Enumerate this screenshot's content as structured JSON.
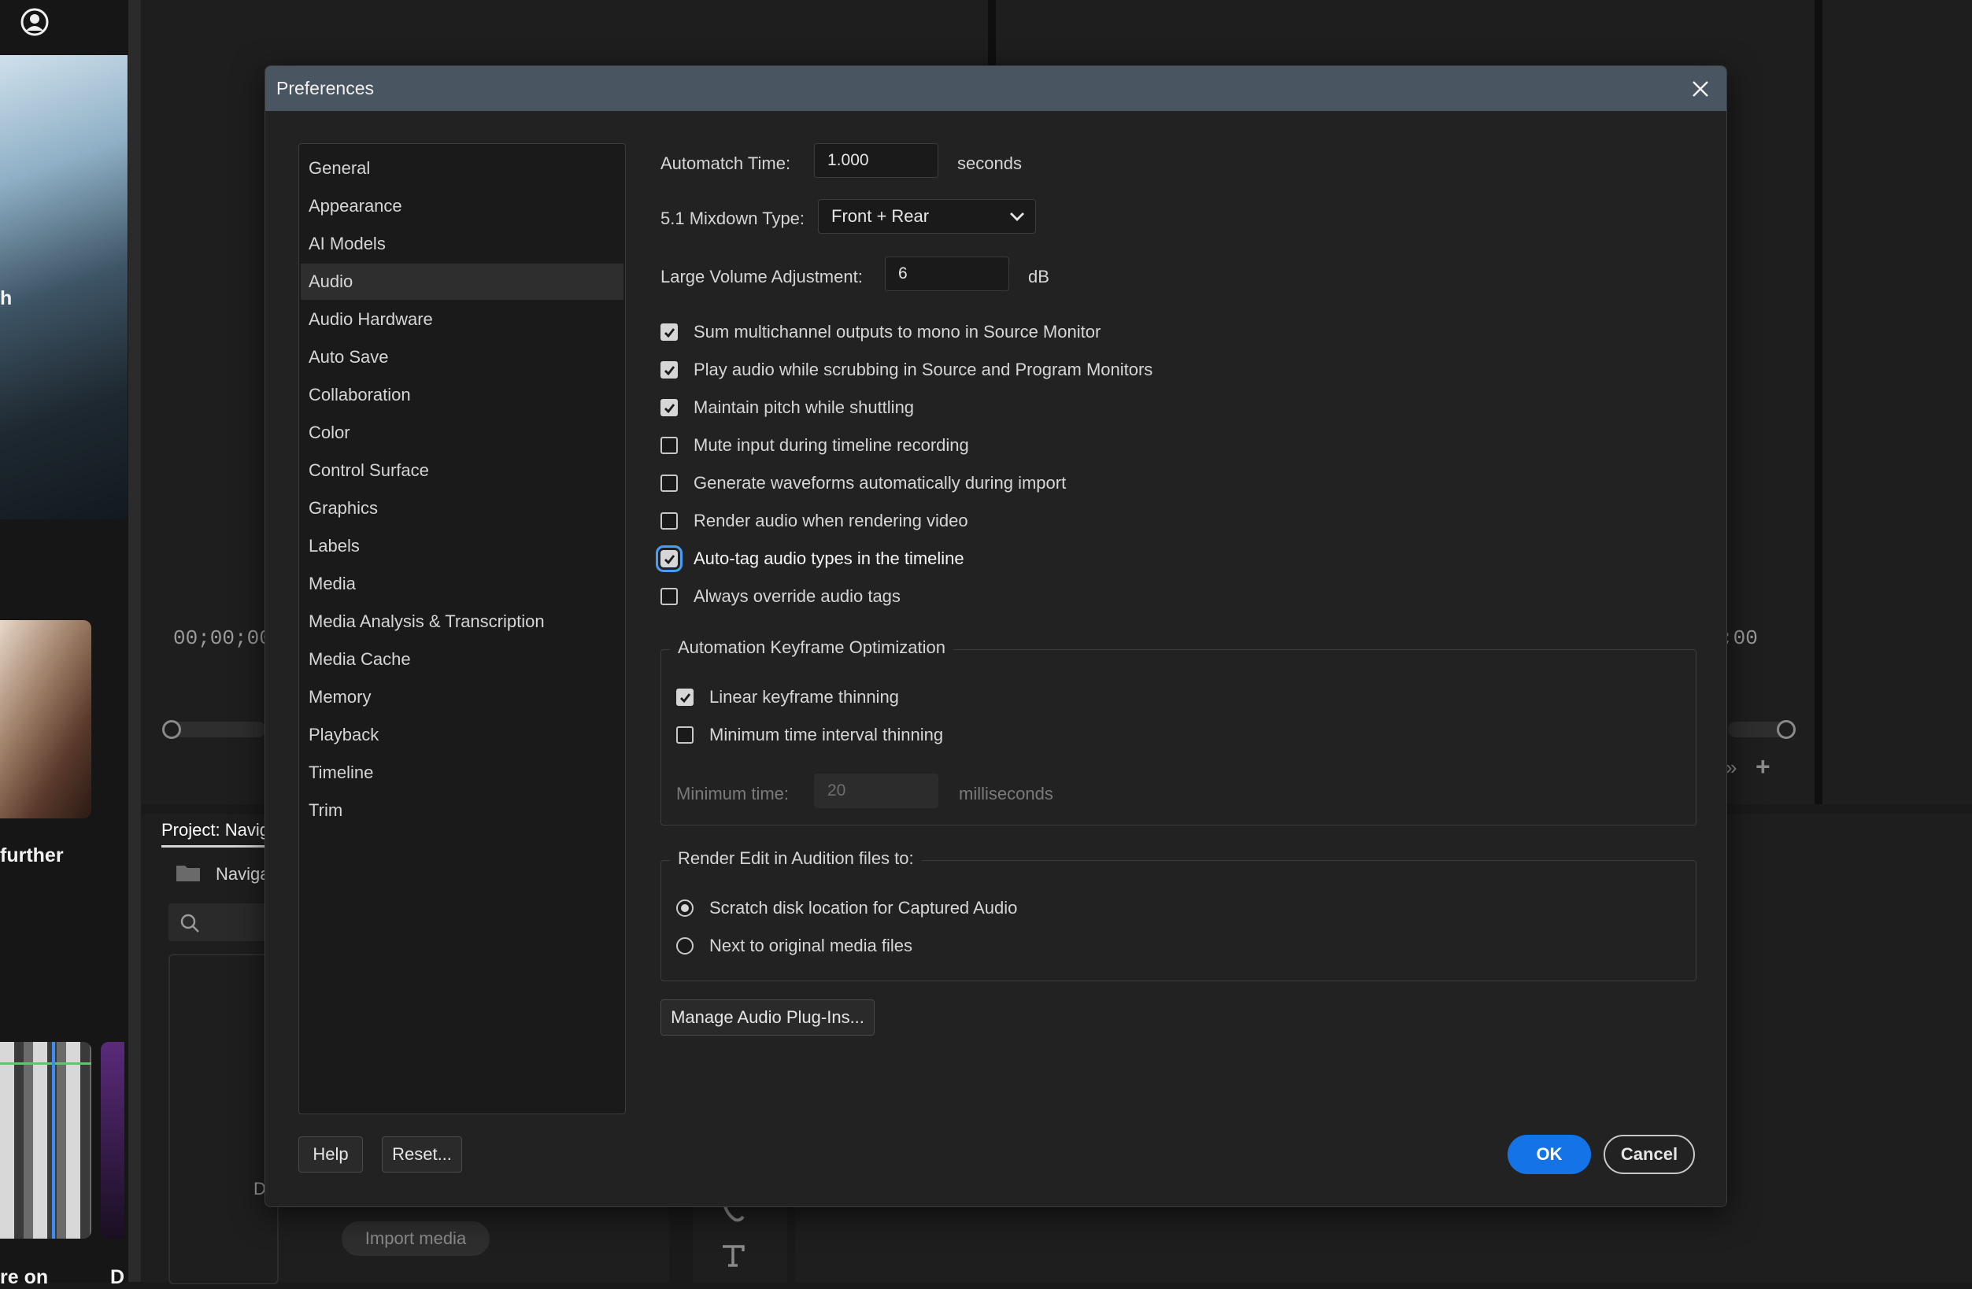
{
  "background": {
    "left_panel_texts": [
      "h",
      "further",
      "re on",
      "D"
    ],
    "source_timecode": "00;00;00",
    "program_timecode": ";00",
    "project_tab": "Project: Navig",
    "project_folder": "Naviga",
    "project_item_letter": "D",
    "import_media_label": "Import media"
  },
  "dialog": {
    "title": "Preferences",
    "categories": [
      "General",
      "Appearance",
      "AI Models",
      "Audio",
      "Audio Hardware",
      "Auto Save",
      "Collaboration",
      "Color",
      "Control Surface",
      "Graphics",
      "Labels",
      "Media",
      "Media Analysis & Transcription",
      "Media Cache",
      "Memory",
      "Playback",
      "Timeline",
      "Trim"
    ],
    "selected_category": "Audio",
    "audio": {
      "automatch_label": "Automatch Time:",
      "automatch_value": "1.000",
      "automatch_unit": "seconds",
      "mixdown_label": "5.1 Mixdown Type:",
      "mixdown_value": "Front + Rear",
      "large_volume_label": "Large Volume Adjustment:",
      "large_volume_value": "6",
      "large_volume_unit": "dB",
      "checkboxes": [
        {
          "label": "Sum multichannel outputs to mono in Source Monitor",
          "checked": true
        },
        {
          "label": "Play audio while scrubbing in Source and Program Monitors",
          "checked": true
        },
        {
          "label": "Maintain pitch while shuttling",
          "checked": true
        },
        {
          "label": "Mute input during timeline recording",
          "checked": false
        },
        {
          "label": "Generate waveforms automatically during import",
          "checked": false
        },
        {
          "label": "Render audio when rendering video",
          "checked": false
        },
        {
          "label": "Auto-tag audio types in the timeline",
          "checked": true
        },
        {
          "label": "Always override audio tags",
          "checked": false
        }
      ],
      "automation_group": {
        "title": "Automation Keyframe Optimization",
        "linear_label": "Linear keyframe thinning",
        "linear_checked": true,
        "min_interval_label": "Minimum time interval thinning",
        "min_interval_checked": false,
        "min_time_label": "Minimum time:",
        "min_time_value": "20",
        "min_time_unit": "milliseconds"
      },
      "render_group": {
        "title": "Render Edit in Audition files to:",
        "options": [
          "Scratch disk location for Captured Audio",
          "Next to original media files"
        ],
        "selected": "Scratch disk location for Captured Audio"
      },
      "manage_plugins_label": "Manage Audio Plug-Ins..."
    },
    "footer": {
      "help_label": "Help",
      "reset_label": "Reset...",
      "ok_label": "OK",
      "cancel_label": "Cancel"
    }
  },
  "colors": {
    "accent": "#1473e6",
    "focus_ring": "#4b9cf5",
    "titlebar": "#4a5562",
    "dialog_bg": "#222222"
  }
}
